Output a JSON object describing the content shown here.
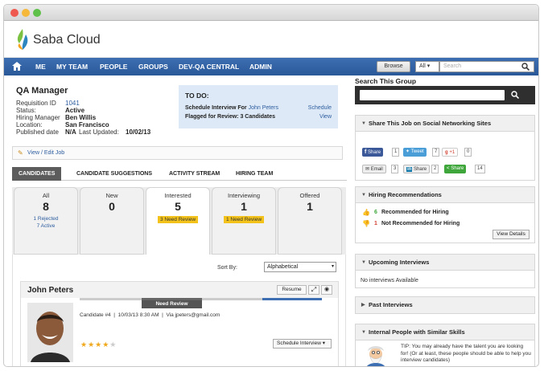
{
  "app": {
    "brand": "Saba Cloud"
  },
  "nav": {
    "items": [
      "ME",
      "MY TEAM",
      "PEOPLE",
      "GROUPS",
      "DEV-QA CENTRAL",
      "ADMIN"
    ],
    "browse": "Browse",
    "scope": "All",
    "search_placeholder": "Search"
  },
  "job": {
    "title": "QA Manager",
    "fields": [
      {
        "label": "Requisition ID",
        "value": "1041"
      },
      {
        "label": "Status:",
        "value": "Active"
      },
      {
        "label": "Hiring Manager",
        "value": "Ben Willis"
      },
      {
        "label": "Location:",
        "value": "San Francisco"
      }
    ],
    "published_label": "Published date",
    "published_value": "N/A",
    "updated_label": "Last Updated:",
    "updated_value": "10/02/13",
    "edit_link": "View / Edit Job"
  },
  "todo": {
    "title": "TO DO:",
    "row1_text": "Schedule Interview For",
    "row1_name": "John Peters",
    "row1_action": "Schedule",
    "row2_text": "Flagged for Review: 3 Candidates",
    "row2_action": "View"
  },
  "tabs": [
    "CANDIDATES",
    "CANDIDATE SUGGESTIONS",
    "ACTIVITY STREAM",
    "HIRING TEAM"
  ],
  "stages": [
    {
      "name": "All",
      "count": "8",
      "rejected": "1 Rejected",
      "active": "7 Active"
    },
    {
      "name": "New",
      "count": "0"
    },
    {
      "name": "Interested",
      "count": "5",
      "badge": "3 Need Review"
    },
    {
      "name": "Interviewing",
      "count": "1",
      "badge": "1 Need Review"
    },
    {
      "name": "Offered",
      "count": "1"
    }
  ],
  "sort": {
    "label": "Sort By:",
    "value": "Alphabetical"
  },
  "candidate": {
    "name": "John Peters",
    "resume": "Resume",
    "status": "Need Review",
    "number": "Candidate #4",
    "date": "10/03/13 8:30 AM",
    "via": "Via jpeters@gmail.com",
    "rating": 4,
    "schedule": "Schedule Interview"
  },
  "right": {
    "search_title": "Search This Group",
    "share": {
      "title": "Share This Job on Social Networking Sites",
      "share_label": "Share",
      "share_count": "1",
      "tweet_label": "Tweet",
      "tweet_count": "7",
      "gplus_label": "+1",
      "gplus_count": "0",
      "email_label": "Email",
      "email_count": "3",
      "in_label": "Share",
      "in_count": "2",
      "green_label": "Share",
      "green_count": "14"
    },
    "hiring": {
      "title": "Hiring Recommendations",
      "rec_count": "6",
      "rec_label": "Recommended for Hiring",
      "notrec_count": "1",
      "notrec_label": "Not Recommended for Hiring",
      "details": "View Details"
    },
    "upcoming": {
      "title": "Upcoming Interviews",
      "empty": "No interviews Available"
    },
    "past": {
      "title": "Past Interviews"
    },
    "internal": {
      "title": "Internal People with Similar Skills",
      "tip": "TIP: You may already have the talent you are looking for! (Or at least, these people should be able to help you interview candidates)"
    }
  },
  "colors": {
    "nav": "#2f5f9f",
    "todo_bg": "#dde9f6",
    "badge": "#f3c31b",
    "stage_bar_active": "#3d6fb2"
  }
}
